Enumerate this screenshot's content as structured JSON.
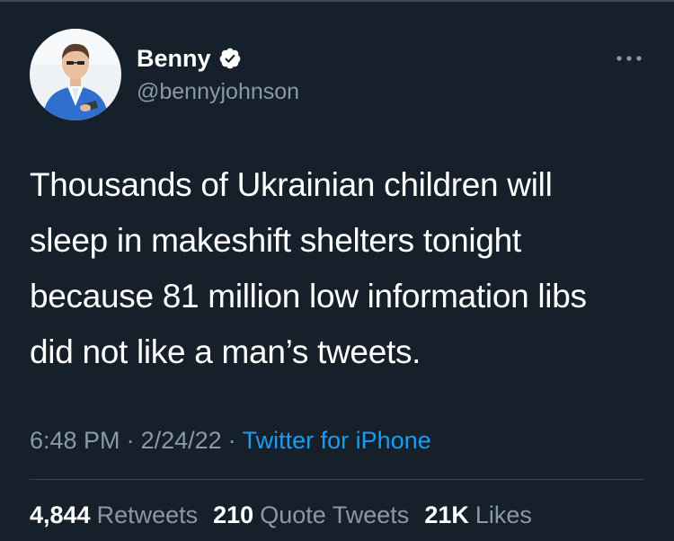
{
  "tweet": {
    "author": {
      "display_name": "Benny",
      "handle": "@bennyjohnson",
      "verified": true,
      "avatar_icon": "profile-photo"
    },
    "text_lines": [
      "Thousands of Ukrainian children will",
      "sleep in makeshift shelters tonight",
      "because 81 million low information libs",
      "did not like a man’s tweets."
    ],
    "time": "6:48 PM",
    "date": "2/24/22",
    "separator": "·",
    "source": "Twitter for iPhone",
    "stats": {
      "retweets": {
        "count": "4,844",
        "label": "Retweets"
      },
      "quote_tweets": {
        "count": "210",
        "label": "Quote Tweets"
      },
      "likes": {
        "count": "21K",
        "label": "Likes"
      }
    }
  },
  "colors": {
    "background": "#15202b",
    "text": "#ffffff",
    "secondary_text": "#8b98a5",
    "link": "#1d9bf0",
    "divider": "#38444d"
  }
}
